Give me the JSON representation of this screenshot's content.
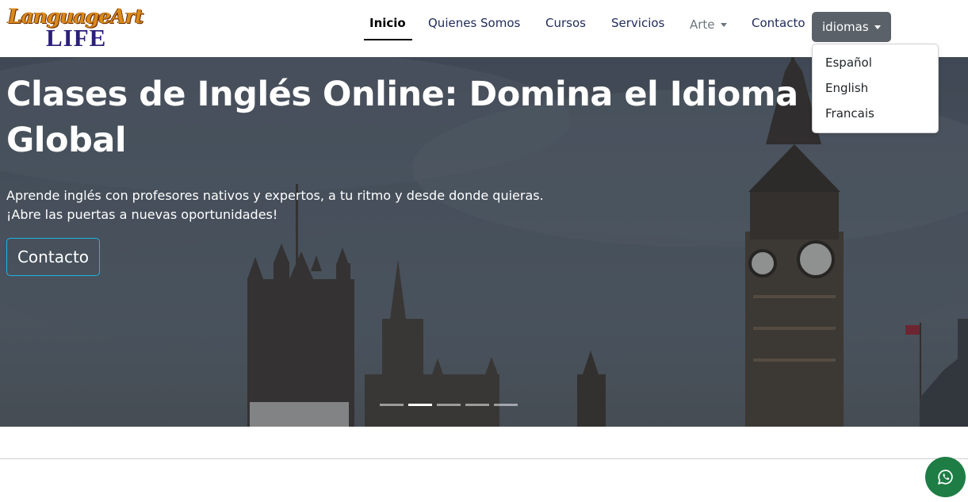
{
  "logo": {
    "line1": "LanguageArt",
    "line2": "LIFE"
  },
  "nav": {
    "items": [
      {
        "label": "Inicio",
        "active": true
      },
      {
        "label": "Quienes Somos"
      },
      {
        "label": "Cursos"
      },
      {
        "label": "Servicios"
      },
      {
        "label": "Arte",
        "dropdown": true
      },
      {
        "label": "Contacto"
      }
    ],
    "language_button": "idiomas",
    "language_options": [
      "Español",
      "English",
      "Francais"
    ]
  },
  "hero": {
    "title": "Clases de Inglés Online: Domina el Idioma Global",
    "text": "Aprende inglés con profesores nativos y expertos, a tu ritmo y desde donde quieras. ¡Abre las puertas a nuevas oportunidades!",
    "button": "Contacto",
    "slides": 5,
    "active_slide": 2
  },
  "colors": {
    "accent_border": "#1eb4e0",
    "whatsapp": "#1e7d45",
    "lang_button": "#5a6169"
  },
  "icons": {
    "whatsapp": "whatsapp-icon",
    "caret": "caret-down-icon"
  }
}
